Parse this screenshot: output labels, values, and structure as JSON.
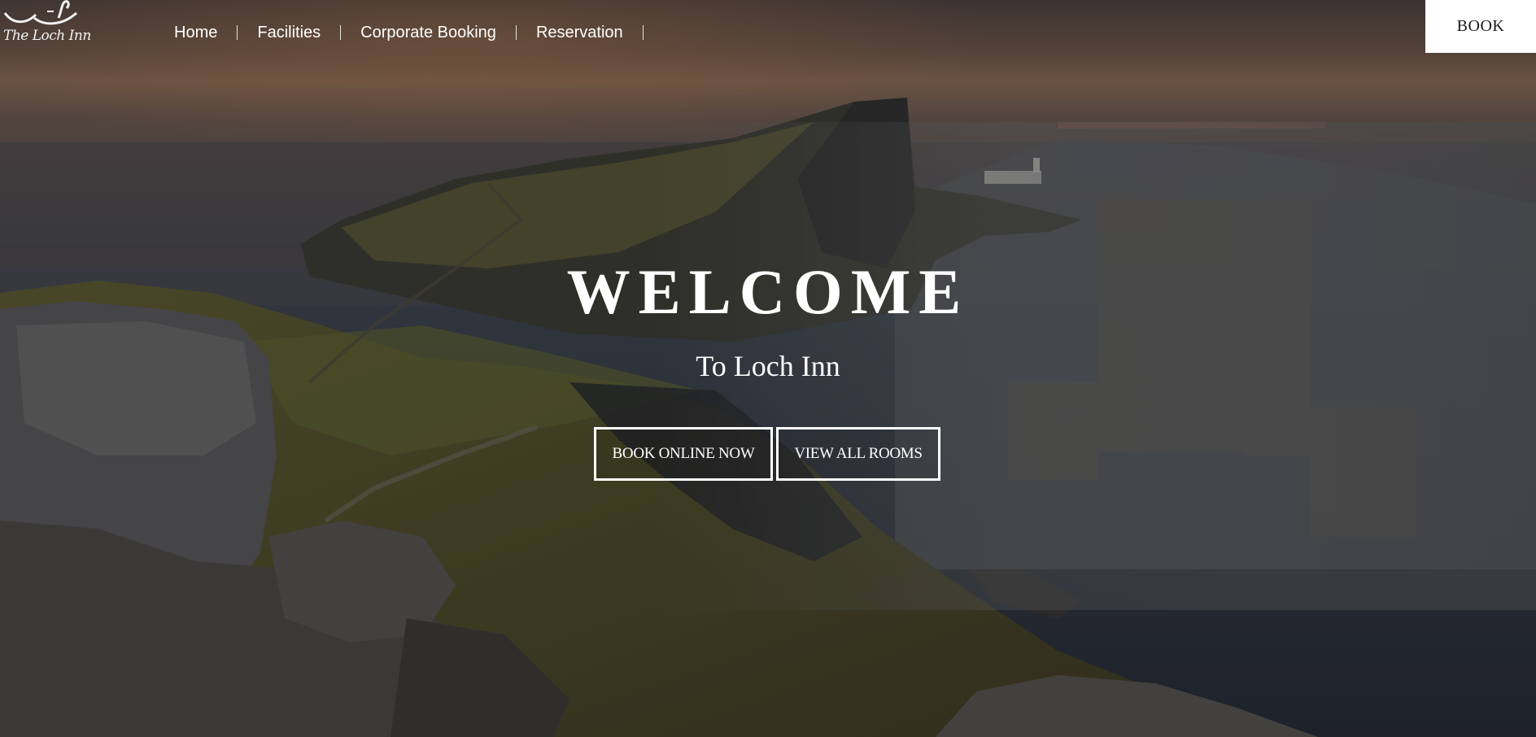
{
  "logo": {
    "text": "The Loch Inn",
    "icon": "swan-logo-icon"
  },
  "nav": {
    "items": [
      {
        "label": "Home"
      },
      {
        "label": "Facilities"
      },
      {
        "label": "Corporate Booking"
      },
      {
        "label": "Reservation"
      }
    ]
  },
  "header": {
    "book_label": "BOOK"
  },
  "hero": {
    "title": "WELCOME",
    "subtitle": "To Loch Inn",
    "buttons": {
      "book_online": "BOOK ONLINE NOW",
      "view_rooms": "VIEW ALL ROOMS"
    }
  },
  "colors": {
    "text": "#ffffff",
    "book_button_bg": "#ffffff",
    "book_button_text": "#1a1a1a"
  }
}
